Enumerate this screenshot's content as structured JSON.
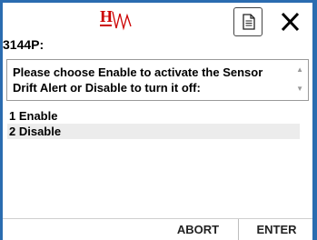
{
  "header": {
    "logo_icon": "hw-logo-icon",
    "document_icon": "document-icon",
    "close_icon": "close-icon",
    "title": "3144P:"
  },
  "prompt": {
    "text": "Please choose Enable to activate the Sensor Drift Alert or Disable to turn it off:"
  },
  "options": [
    {
      "label": "1 Enable"
    },
    {
      "label": "2 Disable"
    }
  ],
  "footer": {
    "abort_label": "ABORT",
    "enter_label": "ENTER"
  },
  "colors": {
    "frame": "#2b6cb0",
    "logo_red": "#cc0000",
    "list_alt_row": "#ececec"
  }
}
